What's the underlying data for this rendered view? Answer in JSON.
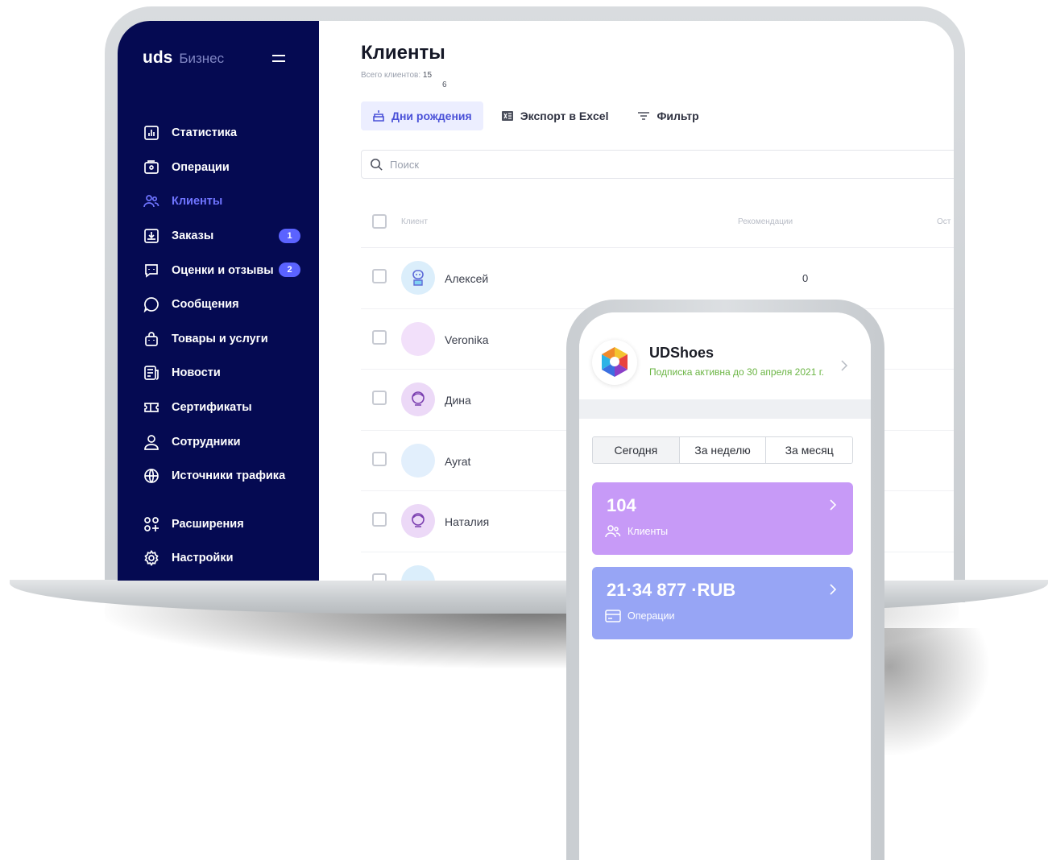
{
  "brand": {
    "logo": "uds",
    "sub": "Бизнес"
  },
  "sidebar": {
    "items": [
      {
        "label": "Статистика",
        "icon": "chart-icon"
      },
      {
        "label": "Операции",
        "icon": "operations-icon"
      },
      {
        "label": "Клиенты",
        "icon": "users-icon",
        "active": true
      },
      {
        "label": "Заказы",
        "icon": "download-icon",
        "badge": "1"
      },
      {
        "label": "Оценки и отзывы",
        "icon": "review-icon",
        "badge": "2"
      },
      {
        "label": "Сообщения",
        "icon": "chat-icon"
      },
      {
        "label": "Товары и услуги",
        "icon": "bag-icon"
      },
      {
        "label": "Новости",
        "icon": "news-icon"
      },
      {
        "label": "Сертификаты",
        "icon": "ticket-icon"
      },
      {
        "label": "Сотрудники",
        "icon": "person-icon"
      },
      {
        "label": "Источники трафика",
        "icon": "globe-icon"
      },
      {
        "label": "Расширения",
        "icon": "grid-plus-icon"
      },
      {
        "label": "Настройки",
        "icon": "gear-icon"
      }
    ]
  },
  "main": {
    "title": "Клиенты",
    "total_label": "Всего клиентов:",
    "total_value_line1": "15",
    "total_value_line2": "6",
    "toolbar": {
      "birthdays": "Дни рождения",
      "export": "Экспорт в Excel",
      "filter": "Фильтр"
    },
    "search": {
      "placeholder": "Поиск"
    },
    "table": {
      "headers": [
        "Клиент",
        "Рекомендации",
        "Ост"
      ],
      "rows": [
        {
          "name": "Алексей",
          "recommendations": "0",
          "avatar": "robot-icon"
        },
        {
          "name": "Veronika",
          "recommendations": "",
          "avatar": "blank-pink"
        },
        {
          "name": "Дина",
          "recommendations": "",
          "avatar": "face-icon"
        },
        {
          "name": "Ayrat",
          "recommendations": "",
          "avatar": "blank-blue"
        },
        {
          "name": "Наталия",
          "recommendations": "",
          "avatar": "face-icon"
        }
      ]
    }
  },
  "phone": {
    "company": "UDShoes",
    "subscription": "Подписка активна до 30 апреля 2021 г.",
    "periods": [
      "Сегодня",
      "За неделю",
      "За месяц"
    ],
    "selected_period": "Сегодня",
    "cards": [
      {
        "value": "104",
        "label": "Клиенты",
        "color": "#c79af7",
        "icon": "users-icon"
      },
      {
        "value": "21·34 877 ·RUB",
        "label": "Операции",
        "color": "#97a5f5",
        "icon": "card-icon"
      }
    ]
  },
  "colors": {
    "sidebar_bg": "#050a52",
    "accent": "#5b63ff",
    "active_nav": "#6f74ff",
    "subscription_green": "#6bb544"
  }
}
